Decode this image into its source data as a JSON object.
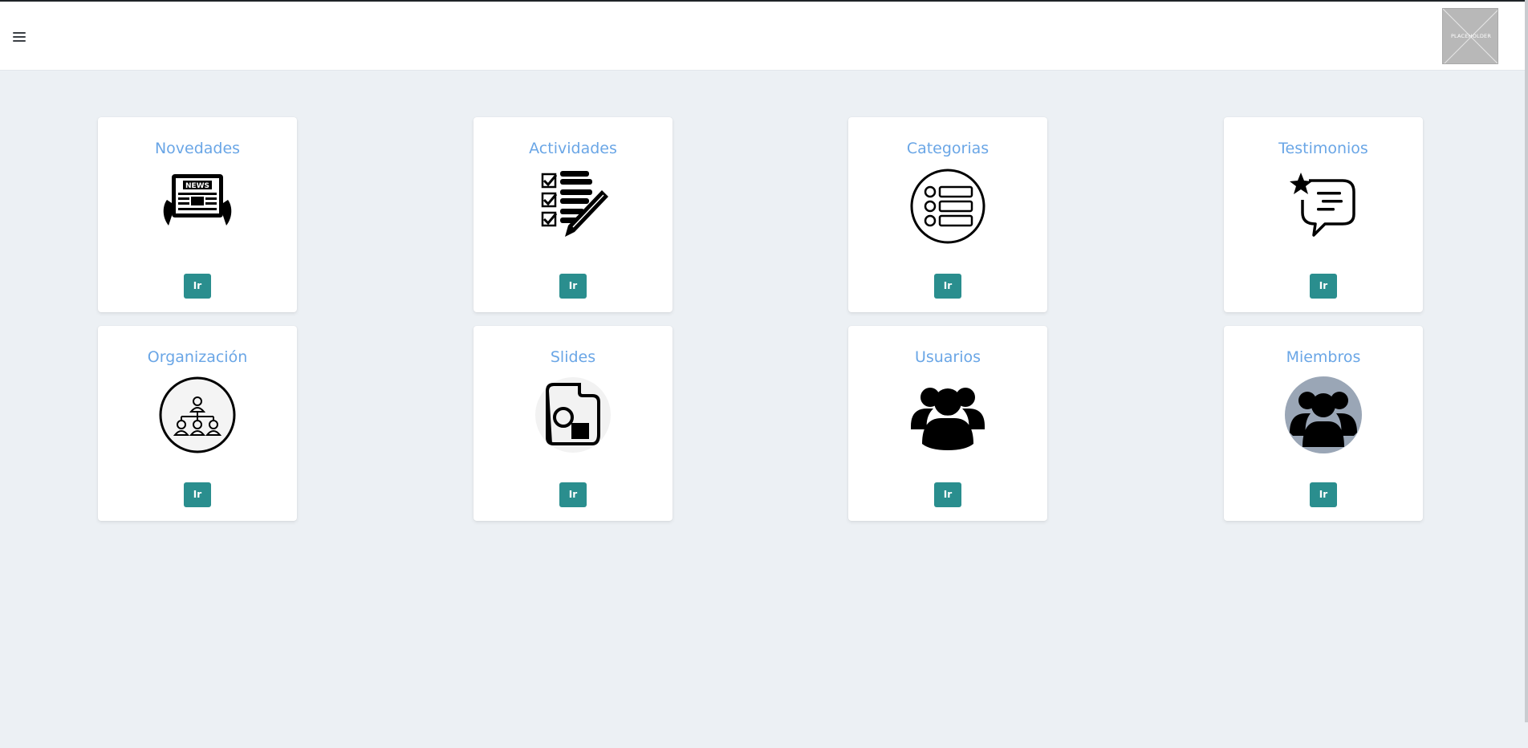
{
  "header": {
    "logo_text": "PLACEHOLDER"
  },
  "colors": {
    "background": "#ecf0f4",
    "title": "#6aa6e6",
    "button": "#2a8e8e"
  },
  "cards": [
    {
      "title": "Novedades",
      "button_label": "Ir",
      "icon": "news-icon"
    },
    {
      "title": "Actividades",
      "button_label": "Ir",
      "icon": "checklist-icon"
    },
    {
      "title": "Categorias",
      "button_label": "Ir",
      "icon": "list-icon"
    },
    {
      "title": "Testimonios",
      "button_label": "Ir",
      "icon": "testimonial-icon"
    },
    {
      "title": "Organización",
      "button_label": "Ir",
      "icon": "organization-icon"
    },
    {
      "title": "Slides",
      "button_label": "Ir",
      "icon": "slides-icon"
    },
    {
      "title": "Usuarios",
      "button_label": "Ir",
      "icon": "users-icon"
    },
    {
      "title": "Miembros",
      "button_label": "Ir",
      "icon": "members-icon"
    }
  ]
}
